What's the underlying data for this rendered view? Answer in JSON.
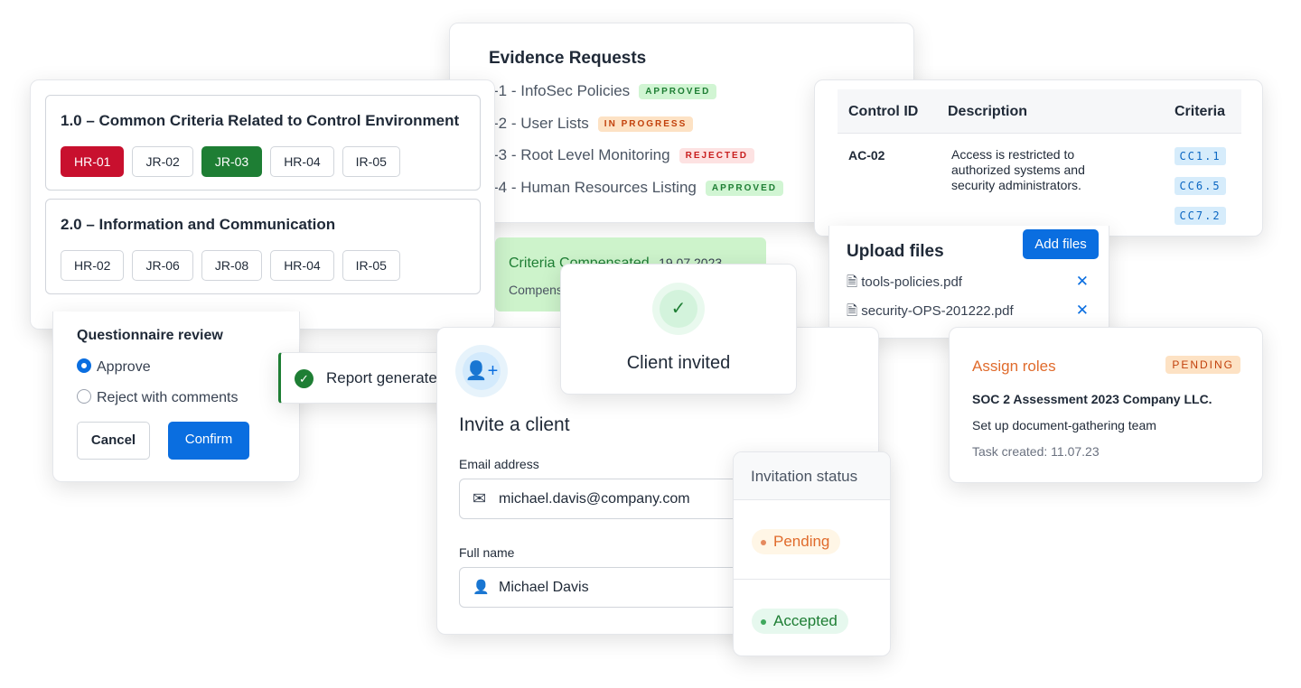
{
  "evidence": {
    "title": "Evidence Requests",
    "items": [
      {
        "label": "-1 - InfoSec Policies",
        "status": "APPROVED"
      },
      {
        "label": "-2 - User Lists",
        "status": "IN PROGRESS"
      },
      {
        "label": "-3 - Root Level Monitoring",
        "status": "REJECTED"
      },
      {
        "label": "-4 - Human Resources Listing",
        "status": "APPROVED"
      }
    ]
  },
  "criteria": {
    "sections": [
      {
        "title": "1.0 – Common Criteria Related to Control Environment",
        "chips": [
          "HR-01",
          "JR-02",
          "JR-03",
          "HR-04",
          "IR-05"
        ]
      },
      {
        "title": "2.0 – Information and Communication",
        "chips": [
          "HR-02",
          "JR-06",
          "JR-08",
          "HR-04",
          "IR-05"
        ]
      }
    ]
  },
  "control": {
    "headers": [
      "Control ID",
      "Description",
      "Criteria"
    ],
    "row": {
      "id": "AC-02",
      "description": "Access is restricted to authorized systems and security administrators.",
      "criteria": [
        "CC1.1",
        "CC6.5",
        "CC7.2"
      ]
    }
  },
  "upload": {
    "title": "Upload files",
    "add_label": "Add files",
    "files": [
      "tools-policies.pdf",
      "security-OPS-201222.pdf"
    ]
  },
  "compensated": {
    "title": "Criteria Compensated",
    "date": "19.07.2023",
    "text": "Compensated"
  },
  "client_invited": {
    "text": "Client invited"
  },
  "questionnaire": {
    "title": "Questionnaire review",
    "options": [
      "Approve",
      "Reject with comments"
    ],
    "selected": "Approve",
    "cancel": "Cancel",
    "confirm": "Confirm"
  },
  "toast": {
    "text": "Report generated"
  },
  "invite": {
    "title": "Invite a client",
    "email_label": "Email address",
    "email_value": "michael.davis@company.com",
    "name_label": "Full name",
    "name_value": "Michael Davis"
  },
  "invitation_status": {
    "header": "Invitation status",
    "statuses": [
      "Pending",
      "Accepted"
    ]
  },
  "assign": {
    "title": "Assign roles",
    "badge": "PENDING",
    "company": "SOC 2 Assessment 2023 Company LLC.",
    "task": "Set up document-gathering team",
    "created": "Task created: 11.07.23"
  },
  "colors": {
    "primary": "#0a6ee0",
    "red": "#c8102e",
    "green": "#1e7e34",
    "orange": "#e06b2c"
  }
}
